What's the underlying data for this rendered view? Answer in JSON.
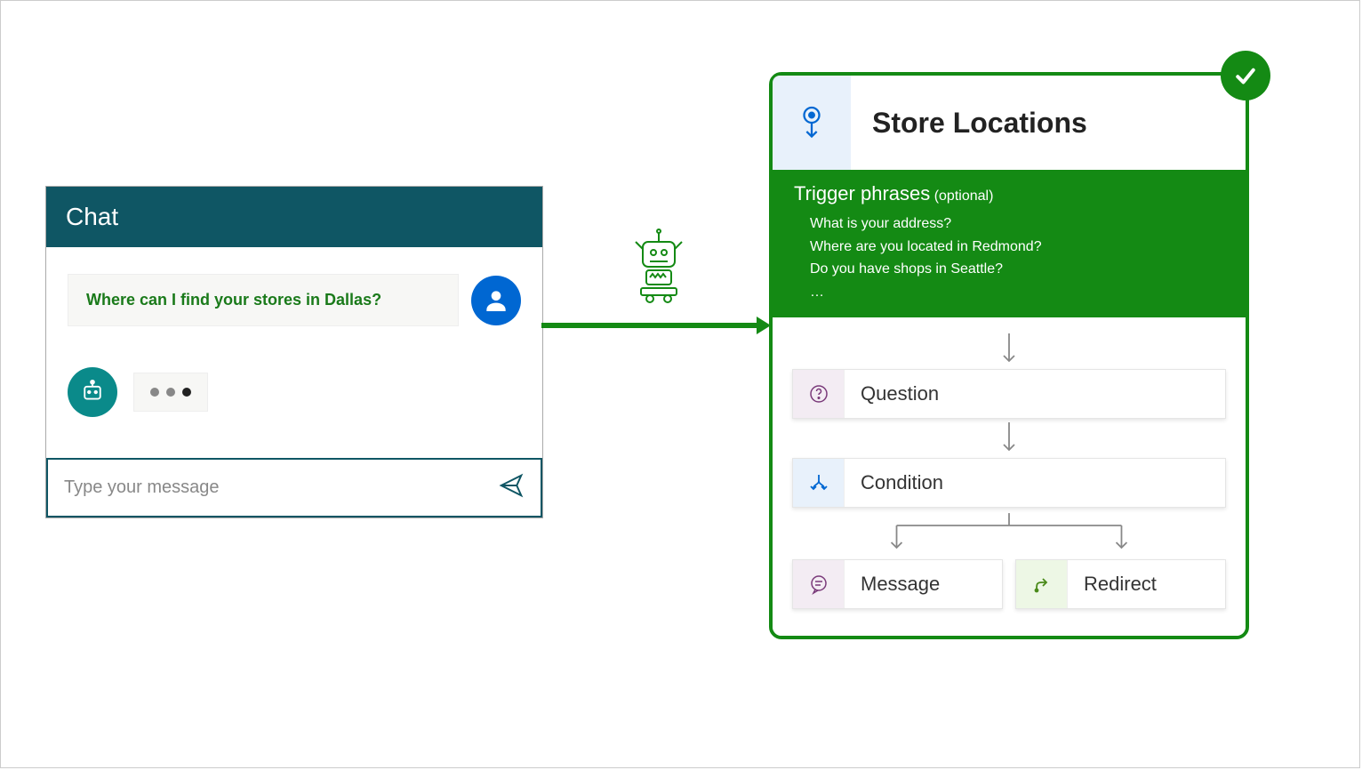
{
  "chat": {
    "title": "Chat",
    "user_message": "Where can I find your stores in Dallas?",
    "input_placeholder": "Type your message"
  },
  "topic": {
    "title": "Store Locations",
    "trigger_label": "Trigger phrases",
    "trigger_optional": "(optional)",
    "phrases": {
      "p0": "What is your address?",
      "p1": "Where are you located in Redmond?",
      "p2": "Do you have shops in Seattle?",
      "more": "…"
    },
    "nodes": {
      "question": "Question",
      "condition": "Condition",
      "message": "Message",
      "redirect": "Redirect"
    }
  }
}
